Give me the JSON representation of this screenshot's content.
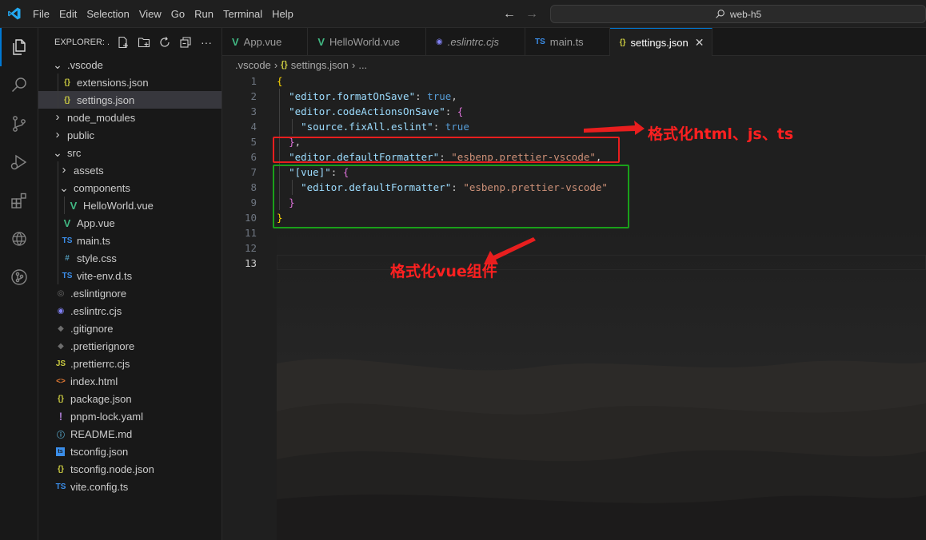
{
  "titlebar": {
    "menu": [
      "File",
      "Edit",
      "Selection",
      "View",
      "Go",
      "Run",
      "Terminal",
      "Help"
    ],
    "search": "web-h5"
  },
  "explorer": {
    "title": "EXPLORER: ...",
    "tree": [
      {
        "label": ".vscode",
        "depth": 0,
        "type": "folder-open",
        "icon": "chevron-down"
      },
      {
        "label": "extensions.json",
        "depth": 1,
        "type": "json"
      },
      {
        "label": "settings.json",
        "depth": 1,
        "type": "json",
        "selected": true
      },
      {
        "label": "node_modules",
        "depth": 0,
        "type": "folder"
      },
      {
        "label": "public",
        "depth": 0,
        "type": "folder"
      },
      {
        "label": "src",
        "depth": 0,
        "type": "folder-open"
      },
      {
        "label": "assets",
        "depth": 1,
        "type": "folder"
      },
      {
        "label": "components",
        "depth": 1,
        "type": "folder-open"
      },
      {
        "label": "HelloWorld.vue",
        "depth": 2,
        "type": "vue"
      },
      {
        "label": "App.vue",
        "depth": 1,
        "type": "vue"
      },
      {
        "label": "main.ts",
        "depth": 1,
        "type": "ts"
      },
      {
        "label": "style.css",
        "depth": 1,
        "type": "css"
      },
      {
        "label": "vite-env.d.ts",
        "depth": 1,
        "type": "ts"
      },
      {
        "label": ".eslintignore",
        "depth": 0,
        "type": "eslintignore"
      },
      {
        "label": ".eslintrc.cjs",
        "depth": 0,
        "type": "eslint"
      },
      {
        "label": ".gitignore",
        "depth": 0,
        "type": "git"
      },
      {
        "label": ".prettierignore",
        "depth": 0,
        "type": "prettierignore"
      },
      {
        "label": ".prettierrc.cjs",
        "depth": 0,
        "type": "js"
      },
      {
        "label": "index.html",
        "depth": 0,
        "type": "html"
      },
      {
        "label": "package.json",
        "depth": 0,
        "type": "json"
      },
      {
        "label": "pnpm-lock.yaml",
        "depth": 0,
        "type": "yaml"
      },
      {
        "label": "README.md",
        "depth": 0,
        "type": "info"
      },
      {
        "label": "tsconfig.json",
        "depth": 0,
        "type": "tsconfig"
      },
      {
        "label": "tsconfig.node.json",
        "depth": 0,
        "type": "json"
      },
      {
        "label": "vite.config.ts",
        "depth": 0,
        "type": "ts"
      }
    ]
  },
  "tabs": [
    {
      "label": "App.vue",
      "type": "vue",
      "italic": false
    },
    {
      "label": "HelloWorld.vue",
      "type": "vue",
      "italic": false
    },
    {
      "label": ".eslintrc.cjs",
      "type": "eslint",
      "italic": true
    },
    {
      "label": "main.ts",
      "type": "ts",
      "italic": false
    },
    {
      "label": "settings.json",
      "type": "json",
      "italic": false,
      "active": true
    }
  ],
  "breadcrumb": [
    ".vscode",
    "settings.json",
    "..."
  ],
  "code": {
    "line_numbers": [
      "1",
      "2",
      "3",
      "4",
      "5",
      "6",
      "7",
      "8",
      "9",
      "10",
      "11",
      "12",
      "13"
    ],
    "current_line": "13",
    "lines": [
      "{",
      "\"editor.formatOnSave\": true,",
      "\"editor.codeActionsOnSave\": {",
      "\"source.fixAll.eslint\": true",
      "},",
      "\"editor.defaultFormatter\": \"esbenp.prettier-vscode\",",
      "\"[vue]\": {",
      "\"editor.defaultFormatter\": \"esbenp.prettier-vscode\"",
      "}",
      "}",
      "",
      "",
      ""
    ]
  },
  "annotations": {
    "red_note": "格式化html、js、ts",
    "green_note": "格式化vue组件",
    "red_color": "#e81e1e",
    "green_color": "#1aa01a"
  },
  "colors": {
    "accent": "#0078d4",
    "json_icon": "#cbcb41",
    "vue_icon": "#41b883",
    "ts_icon": "#3b8eea",
    "eslint_icon": "#8080f2"
  }
}
